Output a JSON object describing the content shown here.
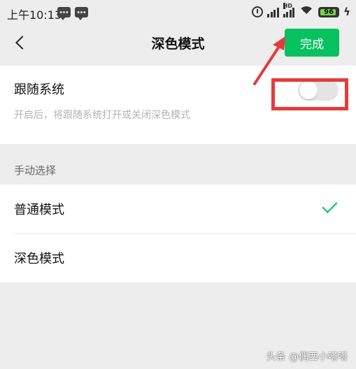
{
  "status_bar": {
    "time": "上午10:13",
    "signal_1_label": "",
    "signal_2_label": "HD",
    "battery_level": "96",
    "icons": [
      "chat-icon",
      "chat-icon",
      "alarm-icon",
      "signal-icon",
      "signal-icon",
      "wifi-icon",
      "battery-icon",
      "charging-icon"
    ]
  },
  "nav": {
    "title": "深色模式",
    "done_label": "完成",
    "back_icon": "chevron-left-icon"
  },
  "follow_system": {
    "title": "跟随系统",
    "description": "开启后，将跟随系统打开或关闭深色模式",
    "enabled": false
  },
  "manual": {
    "section_label": "手动选择",
    "options": [
      {
        "label": "普通模式",
        "selected": true
      },
      {
        "label": "深色模式",
        "selected": false
      }
    ]
  },
  "watermark": "头条 @偶西小嗒嗒",
  "colors": {
    "accent": "#07c160",
    "background": "#ededed",
    "annotation": "#e53b3b"
  }
}
